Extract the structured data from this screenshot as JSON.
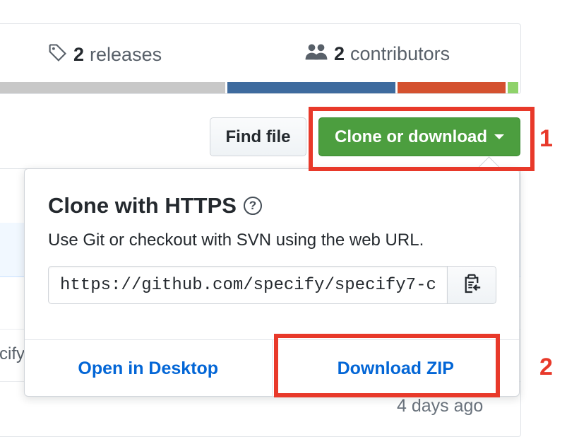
{
  "summary": {
    "releases_count": "2",
    "releases_label": "releases",
    "contributors_count": "2",
    "contributors_label": "contributors"
  },
  "language_bar": {
    "colors": [
      "#c8c8c8",
      "#3e6b9e",
      "#d4512f",
      "#8fd26a"
    ],
    "fractions": [
      0.44,
      0.319,
      0.205,
      0.02
    ]
  },
  "toolbar": {
    "find_file_label": "Find file",
    "clone_label": "Clone or download"
  },
  "clone_panel": {
    "title": "Clone with HTTPS",
    "description": "Use Git or checkout with SVN using the web URL.",
    "url": "https://github.com/specify/specify7-c",
    "open_desktop_label": "Open in Desktop",
    "download_zip_label": "Download ZIP"
  },
  "file_list": {
    "partial_text": "cify",
    "commit_age": "4 days ago"
  },
  "annotations": {
    "first": "1",
    "second": "2",
    "color": "#e8392a"
  },
  "colors": {
    "accent_green": "#4c9e3f",
    "link_blue": "#0366d6"
  }
}
